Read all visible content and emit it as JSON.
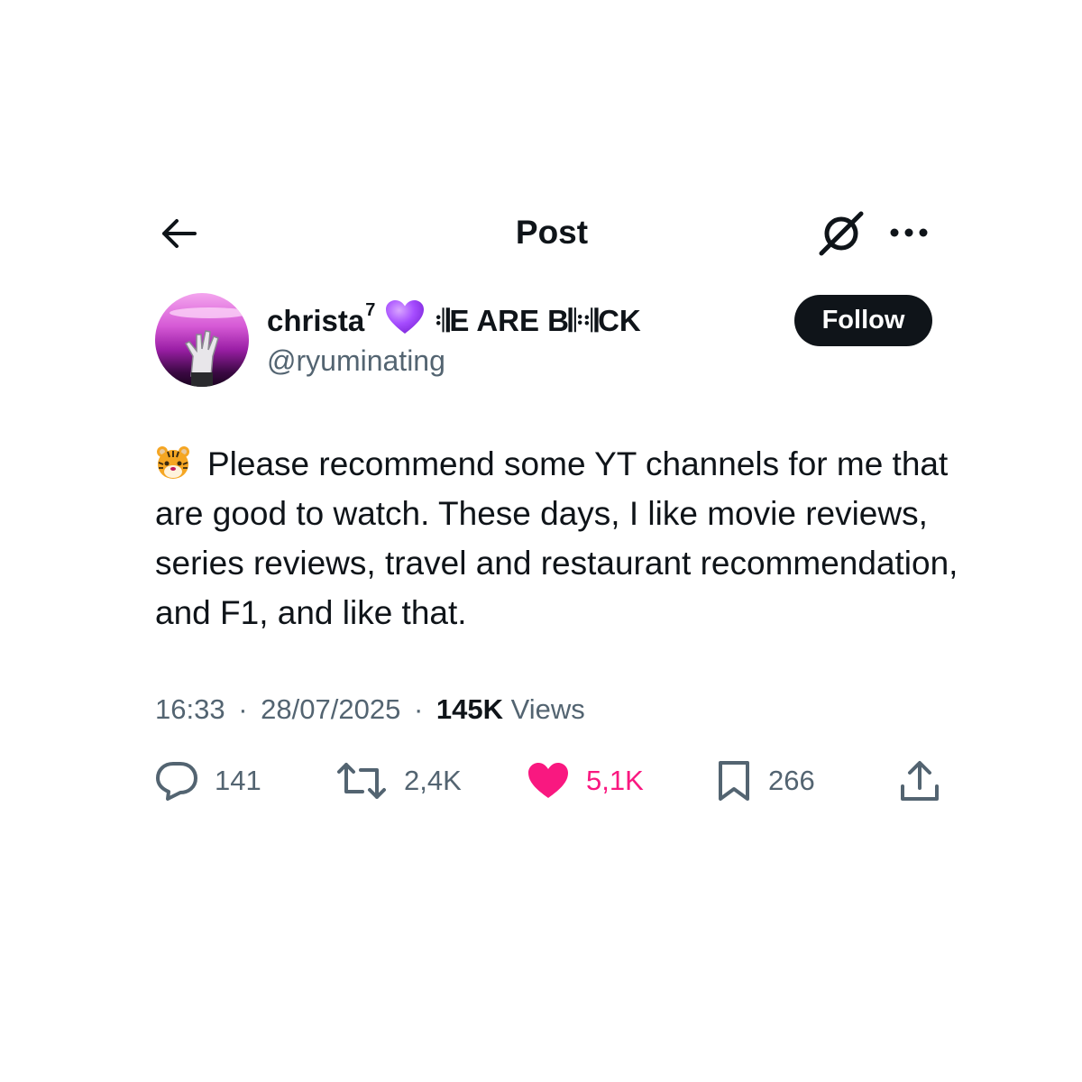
{
  "header": {
    "title": "Post",
    "back_icon": "arrow-left-icon",
    "grok_icon": "grok-icon",
    "more_icon": "more-dots-icon"
  },
  "author": {
    "name": "christa",
    "name_superscript": "7",
    "name_emoji": "purple-heart-icon",
    "name_suffix": "𝄇E ARE B𝄆𝄇CK",
    "handle": "@ryuminating",
    "follow_label": "Follow"
  },
  "post": {
    "emoji": "tiger-face-icon",
    "text": "Please recommend some YT channels for me that are good to watch. These days, I like movie reviews, series reviews, travel and restaurant recommendation, and F1, and like that."
  },
  "meta": {
    "time": "16:33",
    "date": "28/07/2025",
    "views_count": "145K",
    "views_label": "Views",
    "separator": "·"
  },
  "actions": {
    "replies": "141",
    "reposts": "2,4K",
    "likes": "5,1K",
    "bookmarks": "266"
  },
  "colors": {
    "text": "#0f1419",
    "secondary": "#536471",
    "like": "#f91880",
    "heart_emoji": "#a64dff",
    "follow_bg": "#0f1419"
  }
}
